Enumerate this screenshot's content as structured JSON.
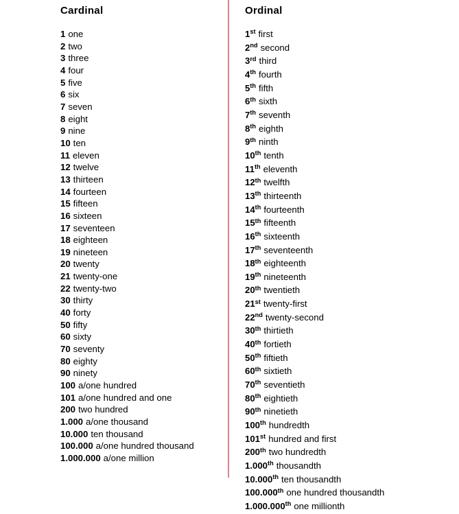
{
  "page": {
    "background_color": "#ffffff",
    "text_color": "#000000",
    "divider_color": "#d9818e"
  },
  "columns": {
    "cardinal": {
      "heading": "Cardinal",
      "entries": [
        {
          "figure": "1",
          "suffix": "",
          "word": "one"
        },
        {
          "figure": "2",
          "suffix": "",
          "word": "two"
        },
        {
          "figure": "3",
          "suffix": "",
          "word": "three"
        },
        {
          "figure": "4",
          "suffix": "",
          "word": "four"
        },
        {
          "figure": "5",
          "suffix": "",
          "word": "five"
        },
        {
          "figure": "6",
          "suffix": "",
          "word": "six"
        },
        {
          "figure": "7",
          "suffix": "",
          "word": "seven"
        },
        {
          "figure": "8",
          "suffix": "",
          "word": "eight"
        },
        {
          "figure": "9",
          "suffix": "",
          "word": "nine"
        },
        {
          "figure": "10",
          "suffix": "",
          "word": "ten"
        },
        {
          "figure": "11",
          "suffix": "",
          "word": "eleven"
        },
        {
          "figure": "12",
          "suffix": "",
          "word": "twelve"
        },
        {
          "figure": "13",
          "suffix": "",
          "word": "thirteen"
        },
        {
          "figure": "14",
          "suffix": "",
          "word": "fourteen"
        },
        {
          "figure": "15",
          "suffix": "",
          "word": "fifteen"
        },
        {
          "figure": "16",
          "suffix": "",
          "word": "sixteen"
        },
        {
          "figure": "17",
          "suffix": "",
          "word": "seventeen"
        },
        {
          "figure": "18",
          "suffix": "",
          "word": "eighteen"
        },
        {
          "figure": "19",
          "suffix": "",
          "word": "nineteen"
        },
        {
          "figure": "20",
          "suffix": "",
          "word": "twenty"
        },
        {
          "figure": "21",
          "suffix": "",
          "word": "twenty-one"
        },
        {
          "figure": "22",
          "suffix": "",
          "word": "twenty-two"
        },
        {
          "figure": "30",
          "suffix": "",
          "word": "thirty"
        },
        {
          "figure": "40",
          "suffix": "",
          "word": "forty"
        },
        {
          "figure": "50",
          "suffix": "",
          "word": "fifty"
        },
        {
          "figure": "60",
          "suffix": "",
          "word": "sixty"
        },
        {
          "figure": "70",
          "suffix": "",
          "word": "seventy"
        },
        {
          "figure": "80",
          "suffix": "",
          "word": "eighty"
        },
        {
          "figure": "90",
          "suffix": "",
          "word": "ninety"
        },
        {
          "figure": "100",
          "suffix": "",
          "word": "a/one hundred"
        },
        {
          "figure": "101",
          "suffix": "",
          "word": "a/one hundred and one"
        },
        {
          "figure": "200",
          "suffix": "",
          "word": "two hundred"
        },
        {
          "figure": "1.000",
          "suffix": "",
          "word": "a/one thousand"
        },
        {
          "figure": "10.000",
          "suffix": "",
          "word": "ten thousand"
        },
        {
          "figure": "100.000",
          "suffix": "",
          "word": "a/one hundred thousand"
        },
        {
          "figure": "1.000.000",
          "suffix": "",
          "word": "a/one million"
        }
      ]
    },
    "ordinal": {
      "heading": "Ordinal",
      "entries": [
        {
          "figure": "1",
          "suffix": "st",
          "word": "first"
        },
        {
          "figure": "2",
          "suffix": "nd",
          "word": "second"
        },
        {
          "figure": "3",
          "suffix": "rd",
          "word": "third"
        },
        {
          "figure": "4",
          "suffix": "th",
          "word": "fourth"
        },
        {
          "figure": "5",
          "suffix": "th",
          "word": "fifth"
        },
        {
          "figure": "6",
          "suffix": "th",
          "word": "sixth"
        },
        {
          "figure": "7",
          "suffix": "th",
          "word": "seventh"
        },
        {
          "figure": "8",
          "suffix": "th",
          "word": "eighth"
        },
        {
          "figure": "9",
          "suffix": "th",
          "word": "ninth"
        },
        {
          "figure": "10",
          "suffix": "th",
          "word": "tenth"
        },
        {
          "figure": "11",
          "suffix": "th",
          "word": "eleventh"
        },
        {
          "figure": "12",
          "suffix": "th",
          "word": "twelfth"
        },
        {
          "figure": "13",
          "suffix": "th",
          "word": "thirteenth"
        },
        {
          "figure": "14",
          "suffix": "th",
          "word": "fourteenth"
        },
        {
          "figure": "15",
          "suffix": "th",
          "word": "fifteenth"
        },
        {
          "figure": "16",
          "suffix": "th",
          "word": "sixteenth"
        },
        {
          "figure": "17",
          "suffix": "th",
          "word": "seventeenth"
        },
        {
          "figure": "18",
          "suffix": "th",
          "word": "eighteenth"
        },
        {
          "figure": "19",
          "suffix": "th",
          "word": "nineteenth"
        },
        {
          "figure": "20",
          "suffix": "th",
          "word": "twentieth"
        },
        {
          "figure": "21",
          "suffix": "st",
          "word": "twenty-first"
        },
        {
          "figure": "22",
          "suffix": "nd",
          "word": "twenty-second"
        },
        {
          "figure": "30",
          "suffix": "th",
          "word": "thirtieth"
        },
        {
          "figure": "40",
          "suffix": "th",
          "word": "fortieth"
        },
        {
          "figure": "50",
          "suffix": "th",
          "word": "fiftieth"
        },
        {
          "figure": "60",
          "suffix": "th",
          "word": "sixtieth"
        },
        {
          "figure": "70",
          "suffix": "th",
          "word": "seventieth"
        },
        {
          "figure": "80",
          "suffix": "th",
          "word": "eightieth"
        },
        {
          "figure": "90",
          "suffix": "th",
          "word": "ninetieth"
        },
        {
          "figure": "100",
          "suffix": "th",
          "word": "hundredth"
        },
        {
          "figure": "101",
          "suffix": "st",
          "word": "hundred and first"
        },
        {
          "figure": "200",
          "suffix": "th",
          "word": "two hundredth"
        },
        {
          "figure": "1.000",
          "suffix": "th",
          "word": "thousandth"
        },
        {
          "figure": "10.000",
          "suffix": "th",
          "word": "ten thousandth"
        },
        {
          "figure": "100.000",
          "suffix": "th",
          "word": "one hundred thousandth"
        },
        {
          "figure": "1.000.000",
          "suffix": "th",
          "word": "one millionth"
        }
      ]
    }
  }
}
